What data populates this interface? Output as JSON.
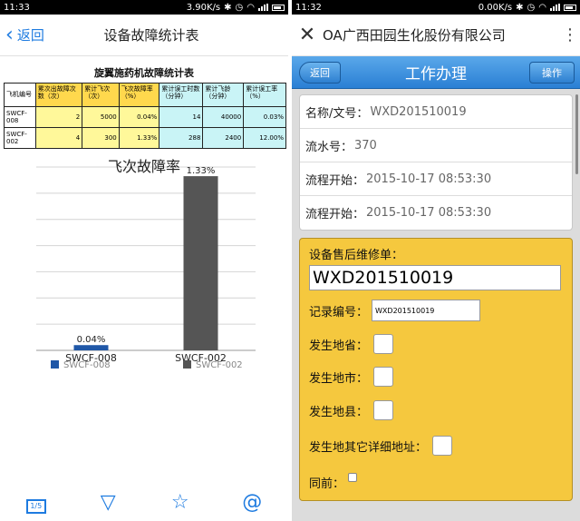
{
  "left": {
    "status": {
      "time": "11:33",
      "speed": "3.90K/s"
    },
    "header": {
      "back_label": "返回",
      "title": "设备故障统计表"
    },
    "table": {
      "title": "旋翼施药机故障统计表",
      "headers": [
        "飞机编号",
        "累次出故障次数（次）",
        "累计飞次（次）",
        "飞次故障率（%）",
        "累计误工时数（分钟）",
        "累计飞龄（分钟）",
        "累计误工率（%）"
      ],
      "rows": [
        [
          "SWCF-008",
          "2",
          "5000",
          "0.04%",
          "14",
          "40000",
          "0.03%"
        ],
        [
          "SWCF-002",
          "4",
          "300",
          "1.33%",
          "288",
          "2400",
          "12.00%"
        ]
      ]
    },
    "chart_data": {
      "type": "bar",
      "title": "飞次故障率",
      "categories": [
        "SWCF-008",
        "SWCF-002"
      ],
      "values": [
        0.04,
        1.33
      ],
      "data_labels": [
        "0.04%",
        "1.33%"
      ],
      "ylim": [
        0,
        1.4
      ],
      "grid": true,
      "legend": "bottom",
      "legend_entries": [
        "SWCF-008",
        "SWCF-002"
      ],
      "colors": [
        "#1f57a7",
        "#555555"
      ]
    },
    "toolbar": {
      "page_icon_label": "1/5"
    }
  },
  "right": {
    "status": {
      "time": "11:32",
      "speed": "0.00K/s"
    },
    "header": {
      "app_name": "OA广西田园生化股份有限公司"
    },
    "bar": {
      "back_label": "返回",
      "title": "工作办理",
      "action_label": "操作"
    },
    "info": [
      {
        "label": "名称/文号：",
        "value": "WXD201510019"
      },
      {
        "label": "流水号：",
        "value": "370"
      },
      {
        "label": "流程开始：",
        "value": "2015-10-17 08:53:30"
      },
      {
        "label": "流程开始：",
        "value": "2015-10-17 08:53:30"
      }
    ],
    "form": {
      "section_label": "设备售后维修单：",
      "section_value": "WXD201510019",
      "record_label": "记录编号：",
      "record_value": "WXD201510019",
      "province_label": "发生地省：",
      "city_label": "发生地市：",
      "county_label": "发生地县：",
      "address_label": "发生地其它详细地址：",
      "peer_label": "同前："
    }
  }
}
